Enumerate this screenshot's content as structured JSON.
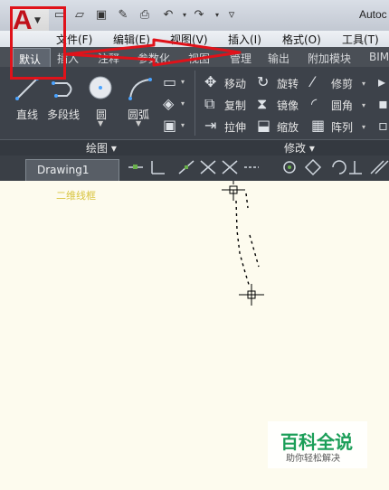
{
  "title_bar": {
    "app_title": "Autoc",
    "app_logo": "A"
  },
  "quick_access": [
    "new-icon",
    "open-icon",
    "save-icon",
    "save-as-icon",
    "print-icon",
    "undo-icon",
    "redo-icon",
    "customize-icon"
  ],
  "menu": [
    "文件(F)",
    "编辑(E)",
    "视图(V)",
    "插入(I)",
    "格式(O)",
    "工具(T)"
  ],
  "tabs": [
    "默认",
    "插入",
    "注释",
    "参数化",
    "视图",
    "管理",
    "输出",
    "附加模块",
    "BIM"
  ],
  "draw_tools": {
    "line": "直线",
    "polyline": "多段线",
    "circle": "圆",
    "arc": "圆弧"
  },
  "modify_tools": {
    "move": "移动",
    "rotate": "旋转",
    "trim": "修剪",
    "copy": "复制",
    "mirror": "镜像",
    "fillet": "圆角",
    "stretch": "拉伸",
    "scale": "缩放",
    "array": "阵列"
  },
  "panels": {
    "draw": "绘图 ▾",
    "modify": "修改 ▾"
  },
  "document": {
    "tab": "Drawing1",
    "view_label": "二维线框"
  },
  "watermark": {
    "title": "百科全说",
    "subtitle": "助你轻松解决"
  },
  "colors": {
    "annotation_red": "#e0121a",
    "canvas_bg": "#fdfbee",
    "ribbon_bg": "#3d424a"
  }
}
